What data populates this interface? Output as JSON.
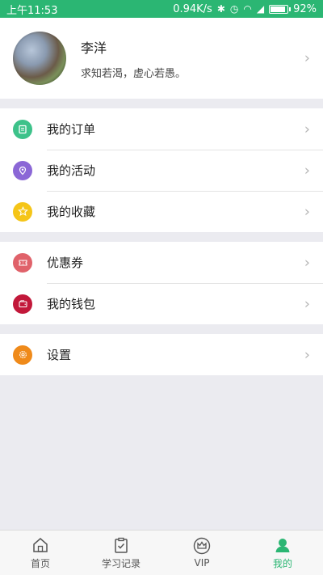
{
  "status_bar": {
    "time": "上午11:53",
    "network_speed": "0.94K/s",
    "battery": "92%",
    "icons": [
      "bluetooth-icon",
      "alarm-icon",
      "wifi-icon",
      "signal-icon",
      "battery-icon"
    ]
  },
  "profile": {
    "name": "李洋",
    "motto": "求知若渴，虚心若愚。"
  },
  "menu_groups": [
    [
      {
        "label": "我的订单",
        "icon": "order-icon",
        "color": "#3dc28a"
      },
      {
        "label": "我的活动",
        "icon": "location-icon",
        "color": "#8b67d6"
      },
      {
        "label": "我的收藏",
        "icon": "star-icon",
        "color": "#f5c518"
      }
    ],
    [
      {
        "label": "优惠券",
        "icon": "coupon-icon",
        "color": "#e0626a"
      },
      {
        "label": "我的钱包",
        "icon": "wallet-icon",
        "color": "#c2183a"
      }
    ],
    [
      {
        "label": "设置",
        "icon": "settings-icon",
        "color": "#ef8a1a"
      }
    ]
  ],
  "tabs": [
    {
      "label": "首页",
      "icon": "home-icon",
      "active": false
    },
    {
      "label": "学习记录",
      "icon": "clipboard-icon",
      "active": false
    },
    {
      "label": "VIP",
      "icon": "crown-icon",
      "active": false
    },
    {
      "label": "我的",
      "icon": "user-icon",
      "active": true
    }
  ],
  "colors": {
    "accent": "#2bb673",
    "background": "#ebebf0",
    "separator": "#e4e4e4"
  }
}
